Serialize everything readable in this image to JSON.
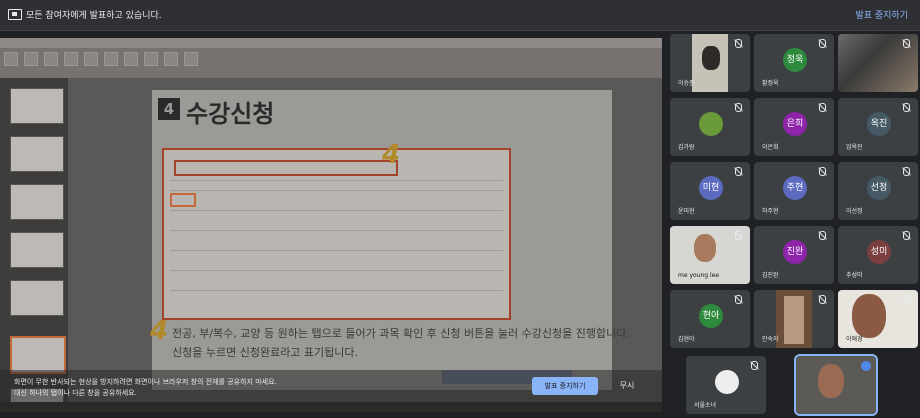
{
  "topbar": {
    "message": "모든 참여자에게 발표하고 있습니다.",
    "stop_label": "발표 중지하기"
  },
  "slide": {
    "section_number": "4",
    "title": "수강신청",
    "step_number": "4",
    "description_line1": "전공, 부/복수, 교양 등 원하는 탭으로 들어가 과목 확인 후 신청 버튼을 눌러 수강신청을 진행합니다.",
    "description_line2": "신청을 누르면 신청완료라고 표기됩니다."
  },
  "share_warning": {
    "line1": "화면이 무한 반사되는 현상을 방지하려면 화면이나 브라우저 창의 전체를 공유하지 마세요.",
    "line2": "대신 하나의 탭이나 다른 창을 공유하세요.",
    "stop_button": "발표 중지하기",
    "ignore_button": "무시"
  },
  "participants": [
    {
      "name": "이승준",
      "type": "video"
    },
    {
      "name": "황정욱",
      "type": "avatar",
      "initials": "정욱",
      "color": "#2e8b3e"
    },
    {
      "name": "",
      "type": "video"
    },
    {
      "name": "김가람",
      "type": "avatar-image"
    },
    {
      "name": "이은희",
      "type": "avatar",
      "initials": "은희",
      "color": "#8e24aa"
    },
    {
      "name": "임옥진",
      "type": "avatar",
      "initials": "옥진",
      "color": "#455a64"
    },
    {
      "name": "윤미현",
      "type": "avatar",
      "initials": "미현",
      "color": "#5c6bc0"
    },
    {
      "name": "하주현",
      "type": "avatar",
      "initials": "주현",
      "color": "#5c6bc0"
    },
    {
      "name": "이선정",
      "type": "avatar",
      "initials": "선정",
      "color": "#455a64"
    },
    {
      "name": "me young lee",
      "type": "video"
    },
    {
      "name": "김진완",
      "type": "avatar",
      "initials": "진완",
      "color": "#8e24aa"
    },
    {
      "name": "추성미",
      "type": "avatar",
      "initials": "성미",
      "color": "#7b3f3f"
    },
    {
      "name": "김현아",
      "type": "avatar",
      "initials": "현아",
      "color": "#2e8b3e"
    },
    {
      "name": "안숙자",
      "type": "video"
    },
    {
      "name": "이애경",
      "type": "video"
    },
    {
      "name": "서울소녀",
      "type": "avatar-image"
    },
    {
      "name": "",
      "type": "video"
    }
  ]
}
